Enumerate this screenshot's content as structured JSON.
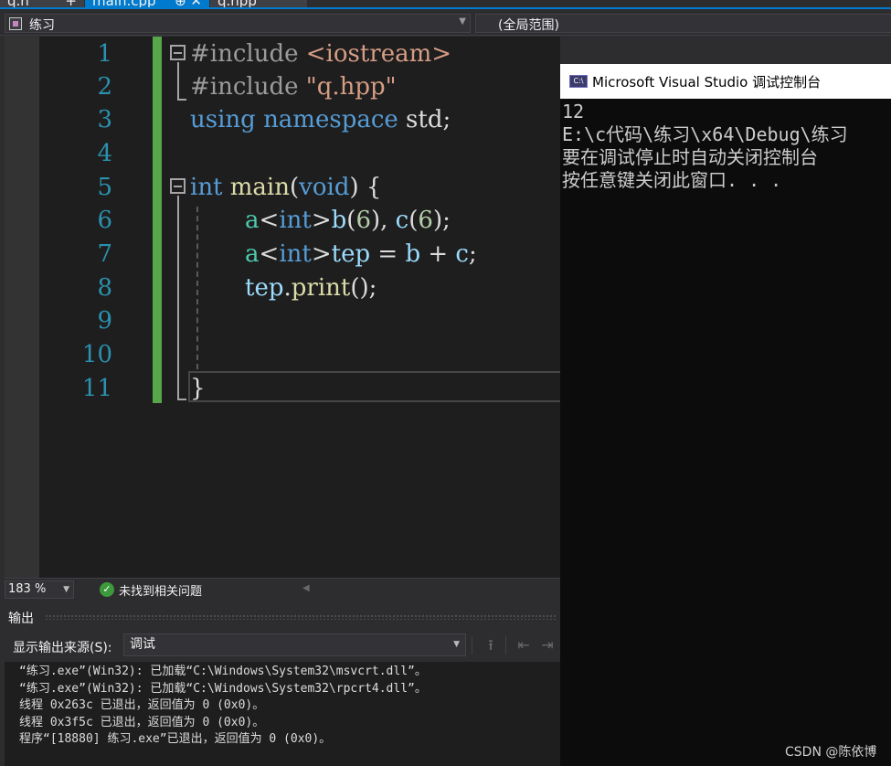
{
  "tabs": [
    {
      "label": "q.h",
      "close": "+"
    },
    {
      "label": "main.cpp",
      "close": "⊕ ✕"
    },
    {
      "label": "q.hpp",
      "close": ""
    }
  ],
  "navbar": {
    "project": "练习",
    "scope": "(全局范围)"
  },
  "editor": {
    "line_numbers": [
      "1",
      "2",
      "3",
      "4",
      "5",
      "6",
      "7",
      "8",
      "9",
      "10",
      "11"
    ],
    "lines": {
      "l1_pp": "#include ",
      "l1_hdr": "<iostream>",
      "l2_pp": "#include ",
      "l2_str": "\"q.hpp\"",
      "l3_using": "using",
      "l3_namespace": "namespace",
      "l3_rest": " std;",
      "l5_int": "int",
      "l5_main": "main",
      "l5_paren_open": "(",
      "l5_void": "void",
      "l5_paren_close": ") {",
      "l6_a": "a",
      "l6_lt": "<",
      "l6_int": "int",
      "l6_gt": ">",
      "l6_b": "b",
      "l6_arg1_open": "(",
      "l6_arg1": "6",
      "l6_arg1_close": "), ",
      "l6_c": "c",
      "l6_arg2_open": "(",
      "l6_arg2": "6",
      "l6_arg2_close": ");",
      "l7_a": "a",
      "l7_lt": "<",
      "l7_int": "int",
      "l7_gt": ">",
      "l7_tep": "tep",
      "l7_eq": " = ",
      "l7_b": "b",
      "l7_plus": " + ",
      "l7_c": "c",
      "l7_semi": ";",
      "l8_tep": "tep",
      "l8_dot": ".",
      "l8_print": "print",
      "l8_rest": "();",
      "l11_brace": "}"
    }
  },
  "editor_status": {
    "zoom": "183 %",
    "issues": "未找到相关问题"
  },
  "console": {
    "title": "Microsoft Visual Studio 调试控制台",
    "icon_text": "C:\\",
    "lines": [
      "12",
      "E:\\c代码\\练习\\x64\\Debug\\练习",
      "要在调试停止时自动关闭控制台",
      "按任意键关闭此窗口. . ."
    ]
  },
  "output": {
    "title": "输出",
    "source_label": "显示输出来源(S):",
    "source_value": "调试",
    "lines": [
      "“练习.exe”(Win32): 已加载“C:\\Windows\\System32\\msvcrt.dll”。",
      "“练习.exe”(Win32): 已加载“C:\\Windows\\System32\\rpcrt4.dll”。",
      "线程 0x263c 已退出，返回值为 0 (0x0)。",
      "线程 0x3f5c 已退出，返回值为 0 (0x0)。",
      "程序“[18880] 练习.exe”已退出，返回值为 0 (0x0)。"
    ]
  },
  "watermark": "CSDN @陈依博",
  "colors": {
    "accent": "#007acc",
    "change_bar": "#57a64a",
    "keyword": "#569cd6",
    "line_number": "#2b91af"
  }
}
